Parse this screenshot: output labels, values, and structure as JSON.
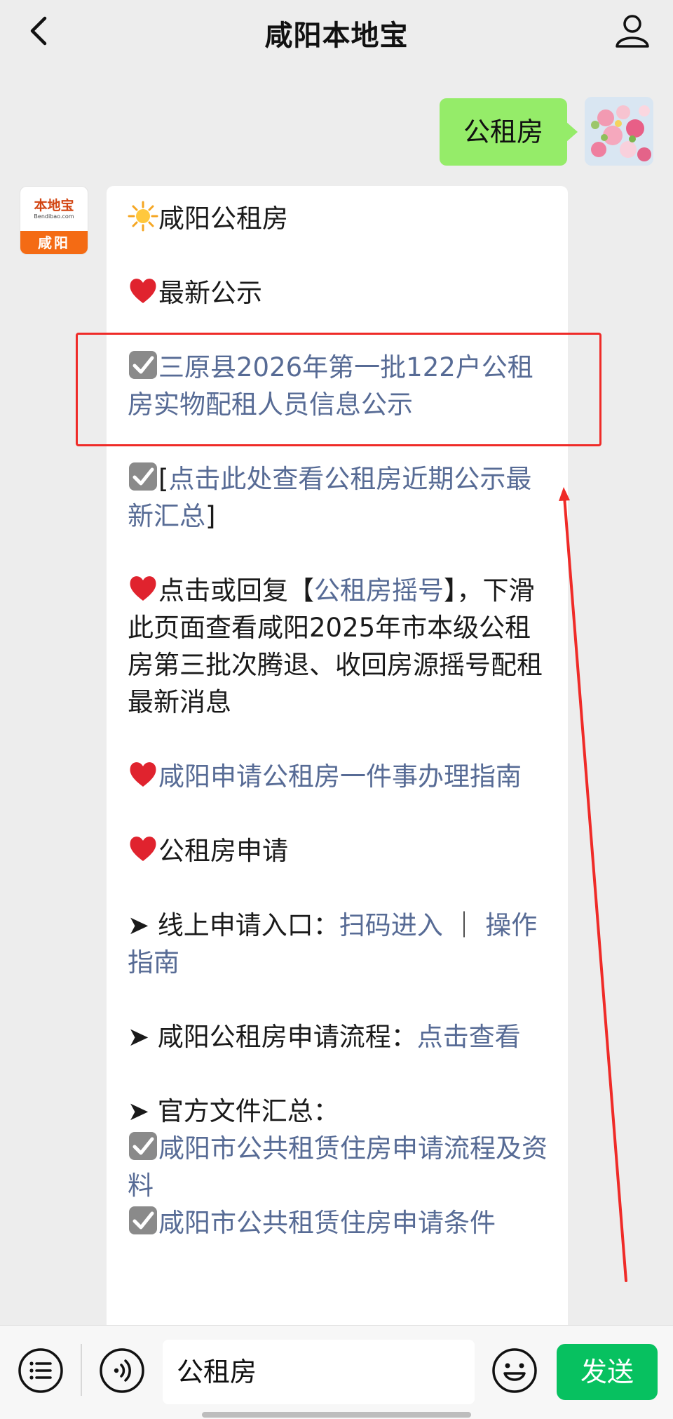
{
  "header": {
    "title": "咸阳本地宝"
  },
  "outgoing": {
    "text": "公租房"
  },
  "bot": {
    "logo_text": "本地宝",
    "logo_sub": "Bendibao.com",
    "city": "咸阳"
  },
  "message": {
    "title": "咸阳公租房",
    "latest_label": "最新公示",
    "notice_link": "三原县2026年第一批122户公租房实物配租人员信息公示",
    "summary_open": "[",
    "summary_link": "点击此处查看公租房近期公示最新汇总",
    "summary_close": "]",
    "lottery_prefix": "点击或回复【",
    "lottery_link": "公租房摇号",
    "lottery_suffix": "】，下滑此页面查看咸阳2025年市本级公租房第三批次腾退、收回房源摇号配租最新消息",
    "guide_link": "咸阳申请公租房一件事办理指南",
    "apply_label": "公租房申请",
    "online_prefix": "➤ 线上申请入口：",
    "online_link1": "扫码进入",
    "online_sep": " ｜ ",
    "online_link2": "操作指南",
    "process_prefix": "➤ 咸阳公租房申请流程：",
    "process_link": "点击查看",
    "docs_label": "➤ 官方文件汇总：",
    "doc1": "咸阳市公共租赁住房申请流程及资料",
    "doc2": "咸阳市公共租赁住房申请条件"
  },
  "input": {
    "value": "公租房",
    "send_label": "发送"
  },
  "colors": {
    "link": "#576b95",
    "send": "#07c160",
    "bubble_out": "#95ec69",
    "highlight": "#ef2b28"
  }
}
